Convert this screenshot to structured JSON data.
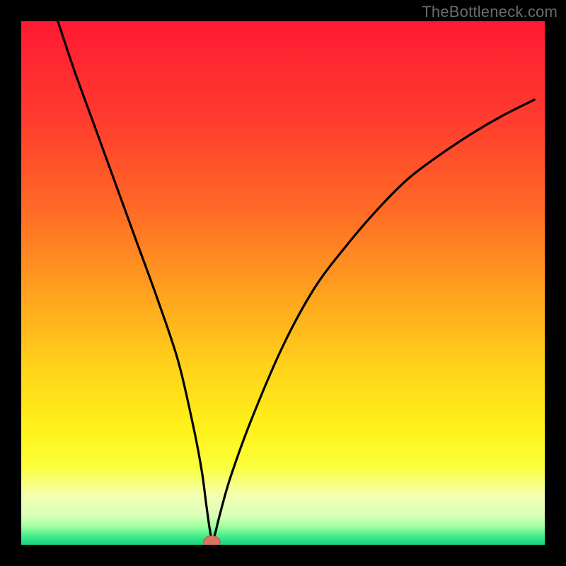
{
  "attribution": "TheBottleneck.com",
  "colors": {
    "frame": "#000000",
    "curve": "#000000",
    "marker_fill": "#d9735f",
    "marker_stroke": "#c45a45",
    "gradient_stops": [
      {
        "offset": 0.0,
        "color": "#ff1a33"
      },
      {
        "offset": 0.18,
        "color": "#ff3a2e"
      },
      {
        "offset": 0.36,
        "color": "#ff6a26"
      },
      {
        "offset": 0.52,
        "color": "#ffa21e"
      },
      {
        "offset": 0.66,
        "color": "#ffd21a"
      },
      {
        "offset": 0.78,
        "color": "#fff21a"
      },
      {
        "offset": 0.85,
        "color": "#fbff3a"
      },
      {
        "offset": 0.905,
        "color": "#f5ffb0"
      },
      {
        "offset": 0.945,
        "color": "#d8ffb8"
      },
      {
        "offset": 0.965,
        "color": "#9effa0"
      },
      {
        "offset": 0.985,
        "color": "#3fe98a"
      },
      {
        "offset": 1.0,
        "color": "#16d47b"
      }
    ]
  },
  "chart_data": {
    "type": "line",
    "title": "",
    "xlabel": "",
    "ylabel": "",
    "xlim": [
      0,
      100
    ],
    "ylim": [
      0,
      100
    ],
    "grid": false,
    "legend": false,
    "series": [
      {
        "name": "curve",
        "x": [
          7,
          10,
          14,
          18,
          22,
          26,
          30,
          33,
          34.5,
          35.3,
          36,
          36.5,
          37,
          38,
          40,
          44,
          50,
          56,
          62,
          68,
          74,
          80,
          86,
          92,
          98
        ],
        "y": [
          100,
          91,
          80,
          69,
          58,
          47,
          35,
          22,
          14,
          8,
          3,
          0.7,
          2,
          6,
          13,
          24,
          38,
          49,
          57,
          64,
          70,
          74.5,
          78.5,
          82,
          85
        ]
      }
    ],
    "marker": {
      "x": 36.4,
      "y": 0.6,
      "rx": 1.6,
      "ry": 1.1
    },
    "notes": "y represents a bottleneck-style metric that reaches ~0 near x≈36.5 and rises on both sides; background is a vertical heat gradient red→green"
  }
}
